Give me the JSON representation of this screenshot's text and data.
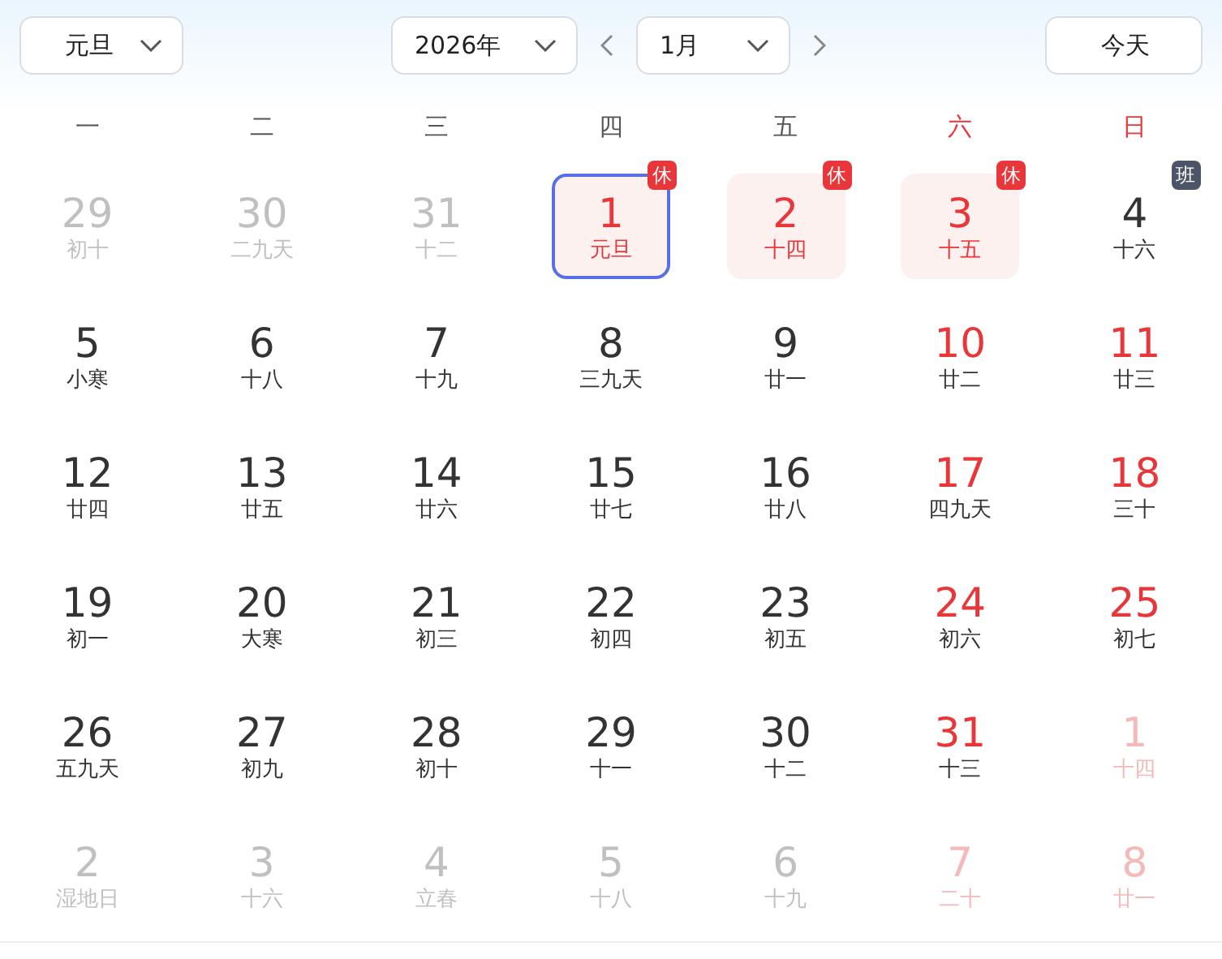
{
  "toolbar": {
    "festival_select": "元旦",
    "year_select": "2026年",
    "month_select": "1月",
    "today_button": "今天"
  },
  "weekdays": [
    {
      "label": "一",
      "weekend": false
    },
    {
      "label": "二",
      "weekend": false
    },
    {
      "label": "三",
      "weekend": false
    },
    {
      "label": "四",
      "weekend": false
    },
    {
      "label": "五",
      "weekend": false
    },
    {
      "label": "六",
      "weekend": true
    },
    {
      "label": "日",
      "weekend": true
    }
  ],
  "days": [
    {
      "day": "29",
      "lunar": "初十",
      "muted": true,
      "red": false,
      "selected": false,
      "holiday": false
    },
    {
      "day": "30",
      "lunar": "二九天",
      "muted": true,
      "red": false,
      "selected": false,
      "holiday": false
    },
    {
      "day": "31",
      "lunar": "十二",
      "muted": true,
      "red": false,
      "selected": false,
      "holiday": false
    },
    {
      "day": "1",
      "lunar": "元旦",
      "muted": false,
      "red": true,
      "selected": true,
      "holiday": true,
      "badge": {
        "text": "休",
        "kind": "rest"
      }
    },
    {
      "day": "2",
      "lunar": "十四",
      "muted": false,
      "red": true,
      "selected": false,
      "holiday": true,
      "badge": {
        "text": "休",
        "kind": "rest"
      }
    },
    {
      "day": "3",
      "lunar": "十五",
      "muted": false,
      "red": true,
      "selected": false,
      "holiday": true,
      "badge": {
        "text": "休",
        "kind": "rest"
      }
    },
    {
      "day": "4",
      "lunar": "十六",
      "muted": false,
      "red": false,
      "selected": false,
      "holiday": false,
      "badge": {
        "text": "班",
        "kind": "work"
      }
    },
    {
      "day": "5",
      "lunar": "小寒",
      "muted": false,
      "red": false,
      "selected": false,
      "holiday": false
    },
    {
      "day": "6",
      "lunar": "十八",
      "muted": false,
      "red": false,
      "selected": false,
      "holiday": false
    },
    {
      "day": "7",
      "lunar": "十九",
      "muted": false,
      "red": false,
      "selected": false,
      "holiday": false
    },
    {
      "day": "8",
      "lunar": "三九天",
      "muted": false,
      "red": false,
      "selected": false,
      "holiday": false
    },
    {
      "day": "9",
      "lunar": "廿一",
      "muted": false,
      "red": false,
      "selected": false,
      "holiday": false
    },
    {
      "day": "10",
      "lunar": "廿二",
      "muted": false,
      "red": true,
      "selected": false,
      "holiday": false
    },
    {
      "day": "11",
      "lunar": "廿三",
      "muted": false,
      "red": true,
      "selected": false,
      "holiday": false
    },
    {
      "day": "12",
      "lunar": "廿四",
      "muted": false,
      "red": false,
      "selected": false,
      "holiday": false
    },
    {
      "day": "13",
      "lunar": "廿五",
      "muted": false,
      "red": false,
      "selected": false,
      "holiday": false
    },
    {
      "day": "14",
      "lunar": "廿六",
      "muted": false,
      "red": false,
      "selected": false,
      "holiday": false
    },
    {
      "day": "15",
      "lunar": "廿七",
      "muted": false,
      "red": false,
      "selected": false,
      "holiday": false
    },
    {
      "day": "16",
      "lunar": "廿八",
      "muted": false,
      "red": false,
      "selected": false,
      "holiday": false
    },
    {
      "day": "17",
      "lunar": "四九天",
      "muted": false,
      "red": true,
      "selected": false,
      "holiday": false
    },
    {
      "day": "18",
      "lunar": "三十",
      "muted": false,
      "red": true,
      "selected": false,
      "holiday": false
    },
    {
      "day": "19",
      "lunar": "初一",
      "muted": false,
      "red": false,
      "selected": false,
      "holiday": false
    },
    {
      "day": "20",
      "lunar": "大寒",
      "muted": false,
      "red": false,
      "selected": false,
      "holiday": false
    },
    {
      "day": "21",
      "lunar": "初三",
      "muted": false,
      "red": false,
      "selected": false,
      "holiday": false
    },
    {
      "day": "22",
      "lunar": "初四",
      "muted": false,
      "red": false,
      "selected": false,
      "holiday": false
    },
    {
      "day": "23",
      "lunar": "初五",
      "muted": false,
      "red": false,
      "selected": false,
      "holiday": false
    },
    {
      "day": "24",
      "lunar": "初六",
      "muted": false,
      "red": true,
      "selected": false,
      "holiday": false
    },
    {
      "day": "25",
      "lunar": "初七",
      "muted": false,
      "red": true,
      "selected": false,
      "holiday": false
    },
    {
      "day": "26",
      "lunar": "五九天",
      "muted": false,
      "red": false,
      "selected": false,
      "holiday": false
    },
    {
      "day": "27",
      "lunar": "初九",
      "muted": false,
      "red": false,
      "selected": false,
      "holiday": false
    },
    {
      "day": "28",
      "lunar": "初十",
      "muted": false,
      "red": false,
      "selected": false,
      "holiday": false
    },
    {
      "day": "29",
      "lunar": "十一",
      "muted": false,
      "red": false,
      "selected": false,
      "holiday": false
    },
    {
      "day": "30",
      "lunar": "十二",
      "muted": false,
      "red": false,
      "selected": false,
      "holiday": false
    },
    {
      "day": "31",
      "lunar": "十三",
      "muted": false,
      "red": true,
      "selected": false,
      "holiday": false
    },
    {
      "day": "1",
      "lunar": "十四",
      "muted": true,
      "red": true,
      "selected": false,
      "holiday": false
    },
    {
      "day": "2",
      "lunar": "湿地日",
      "muted": true,
      "red": false,
      "selected": false,
      "holiday": false
    },
    {
      "day": "3",
      "lunar": "十六",
      "muted": true,
      "red": false,
      "selected": false,
      "holiday": false
    },
    {
      "day": "4",
      "lunar": "立春",
      "muted": true,
      "red": false,
      "selected": false,
      "holiday": false
    },
    {
      "day": "5",
      "lunar": "十八",
      "muted": true,
      "red": false,
      "selected": false,
      "holiday": false
    },
    {
      "day": "6",
      "lunar": "十九",
      "muted": true,
      "red": false,
      "selected": false,
      "holiday": false
    },
    {
      "day": "7",
      "lunar": "二十",
      "muted": true,
      "red": true,
      "selected": false,
      "holiday": false
    },
    {
      "day": "8",
      "lunar": "廿一",
      "muted": true,
      "red": true,
      "selected": false,
      "holiday": false
    }
  ]
}
